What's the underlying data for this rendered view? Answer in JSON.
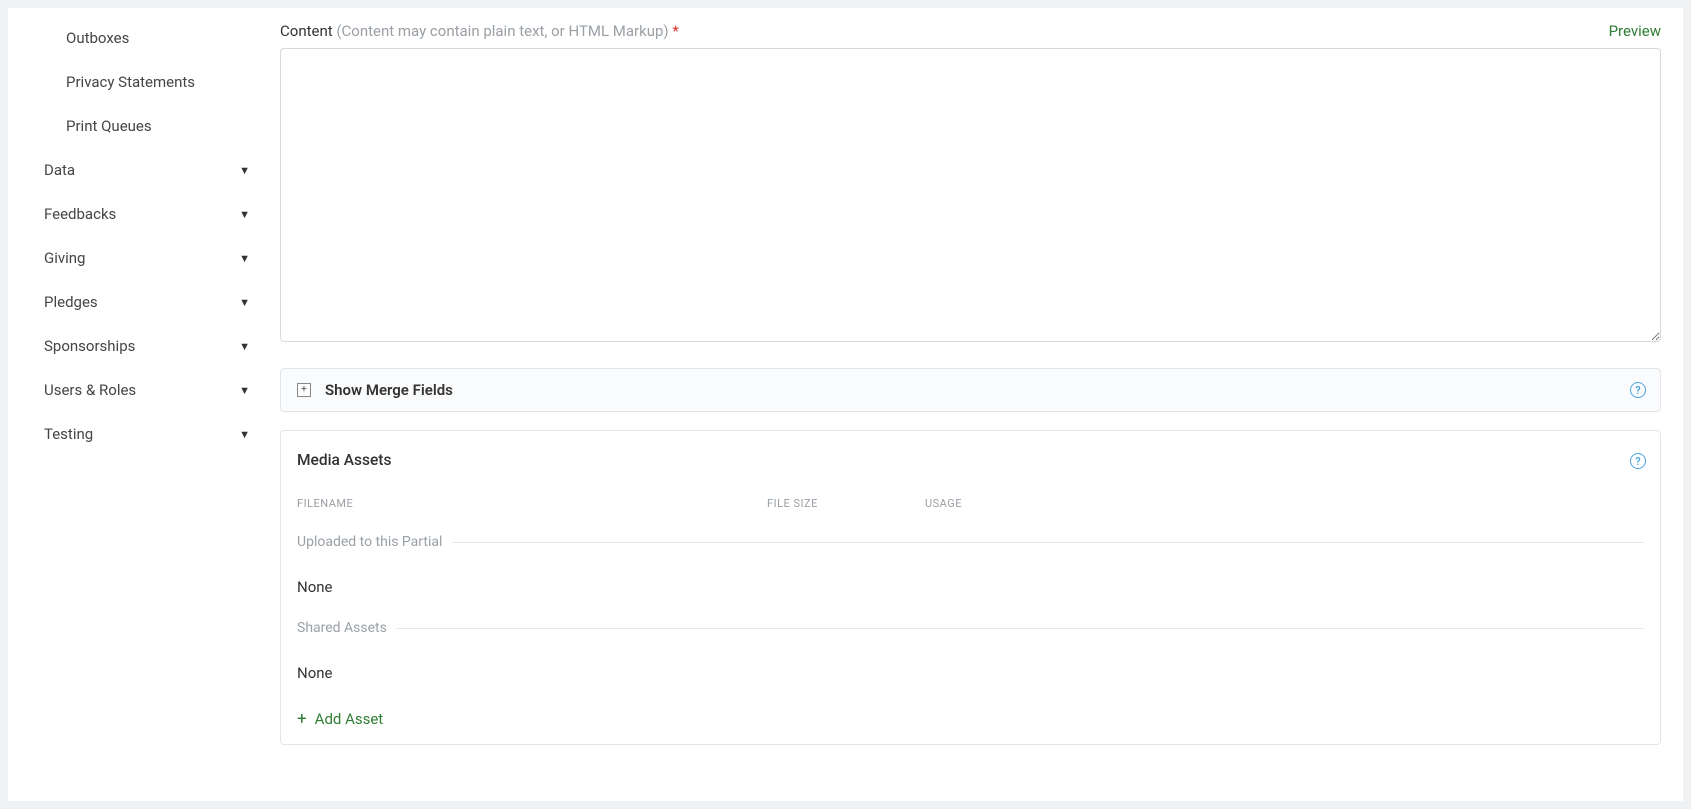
{
  "sidebar": {
    "subitems": [
      {
        "label": "Outboxes"
      },
      {
        "label": "Privacy Statements"
      },
      {
        "label": "Print Queues"
      }
    ],
    "items": [
      {
        "label": "Data"
      },
      {
        "label": "Feedbacks"
      },
      {
        "label": "Giving"
      },
      {
        "label": "Pledges"
      },
      {
        "label": "Sponsorships"
      },
      {
        "label": "Users & Roles"
      },
      {
        "label": "Testing"
      }
    ]
  },
  "content": {
    "label": "Content",
    "hint": "(Content may contain plain text, or HTML Markup)",
    "required": "*",
    "preview": "Preview",
    "value": ""
  },
  "merge_fields": {
    "title": "Show Merge Fields",
    "help": "?"
  },
  "media": {
    "title": "Media Assets",
    "help": "?",
    "columns": {
      "filename": "FILENAME",
      "filesize": "FILE SIZE",
      "usage": "USAGE"
    },
    "uploaded_section": "Uploaded to this Partial",
    "uploaded_none": "None",
    "shared_section": "Shared Assets",
    "shared_none": "None",
    "add_asset": "Add Asset"
  }
}
